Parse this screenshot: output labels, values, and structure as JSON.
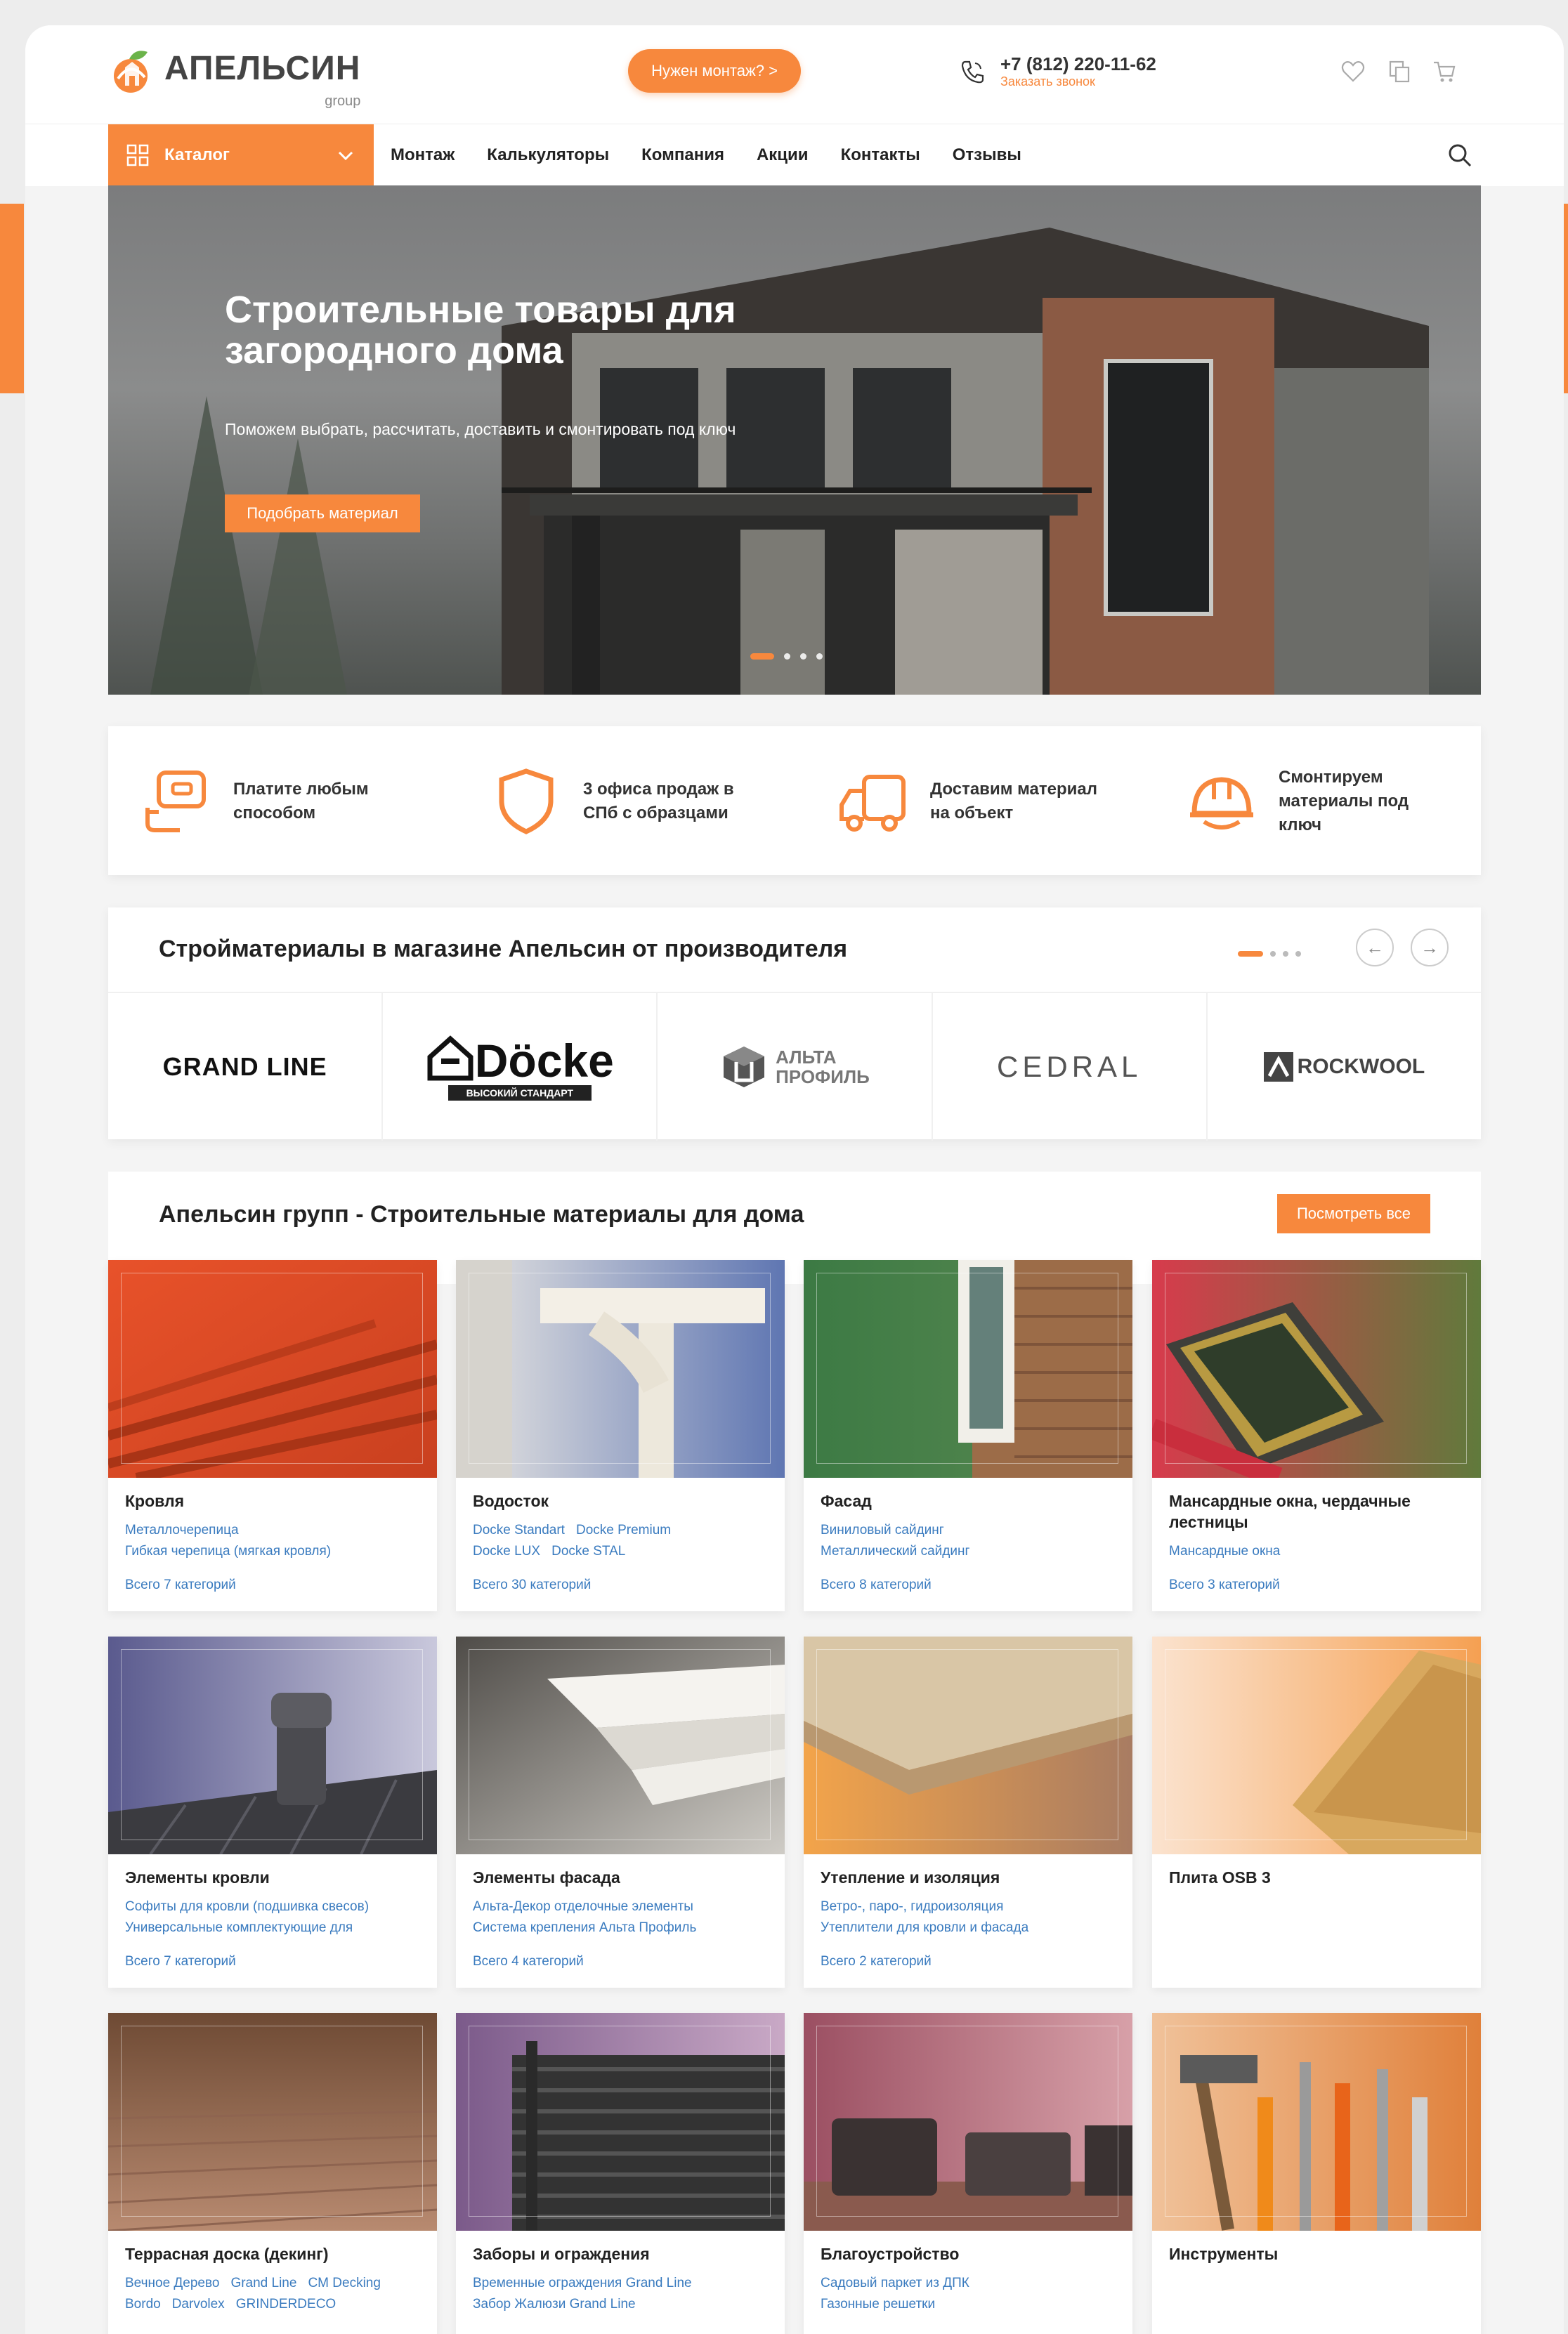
{
  "header": {
    "logo_text": "АПЕЛЬСИН",
    "logo_sub": "group",
    "montage_label": "Нужен монтаж? >",
    "phone": "+7 (812) 220-11-62",
    "callback": "Заказать звонок"
  },
  "nav": {
    "catalog_label": "Каталог",
    "links": [
      "Монтаж",
      "Калькуляторы",
      "Компания",
      "Акции",
      "Контакты",
      "Отзывы"
    ]
  },
  "hero": {
    "title": "Строительные товары для загородного дома",
    "subtitle": "Поможем выбрать, рассчитать, доставить и смонтировать под ключ",
    "button": "Подобрать материал"
  },
  "features": [
    {
      "icon": "wallet-icon",
      "text": "Платите любым способом"
    },
    {
      "icon": "shield-icon",
      "text": "3 офиса продаж в СПб с образцами"
    },
    {
      "icon": "truck-icon",
      "text": "Доставим материал на объект"
    },
    {
      "icon": "helmet-icon",
      "text": "Смонтируем материалы под ключ"
    }
  ],
  "brands": {
    "title": "Стройматериалы в магазине Апельсин от производителя",
    "items": {
      "grandline": "GRAND LINE",
      "docke": "Döcke",
      "docke_tag": "ВЫСОКИЙ СТАНДАРТ",
      "alta1": "АЛЬТА",
      "alta2": "ПРОФИЛЬ",
      "cedral": "CEDRAL",
      "rockwool": "ROCKWOOL"
    }
  },
  "categories": {
    "title": "Апельсин групп - Строительные материалы для дома",
    "view_all": "Посмотреть все",
    "items": [
      {
        "title": "Кровля",
        "sub1": [
          "Металлочерепица"
        ],
        "sub2": [
          "Гибкая черепица (мягкая кровля)"
        ],
        "total": "Всего 7 категорий"
      },
      {
        "title": "Водосток",
        "sub1": [
          "Docke Standart",
          "Docke Premium"
        ],
        "sub2": [
          "Docke LUX",
          "Docke STAL"
        ],
        "total": "Всего 30 категорий"
      },
      {
        "title": "Фасад",
        "sub1": [
          "Виниловый сайдинг"
        ],
        "sub2": [
          "Металлический сайдинг"
        ],
        "total": "Всего 8 категорий"
      },
      {
        "title": "Мансардные окна, чердачные лестницы",
        "sub1": [
          "Мансардные окна"
        ],
        "sub2": [],
        "total": "Всего 3 категорий"
      },
      {
        "title": "Элементы кровли",
        "sub1": [
          "Софиты для кровли (подшивка свесов)"
        ],
        "sub2": [
          "Универсальные комплектующие для"
        ],
        "total": "Всего 7 категорий"
      },
      {
        "title": "Элементы фасада",
        "sub1": [
          "Альта-Декор отделочные элементы"
        ],
        "sub2": [
          "Система крепления Альта Профиль"
        ],
        "total": "Всего 4 категорий"
      },
      {
        "title": "Утепление и изоляция",
        "sub1": [
          "Ветро-, паро-, гидроизоляция"
        ],
        "sub2": [
          "Утеплители для кровли и фасада"
        ],
        "total": "Всего 2 категорий"
      },
      {
        "title": "Плита OSB 3",
        "sub1": [],
        "sub2": [],
        "total": ""
      },
      {
        "title": "Террасная доска (декинг)",
        "sub1": [
          "Вечное Дерево",
          "Grand Line",
          "CM Decking"
        ],
        "sub2": [
          "Bordo",
          "Darvolex",
          "GRINDERDECO"
        ],
        "total": ""
      },
      {
        "title": "Заборы и ограждения",
        "sub1": [
          "Временные ограждения Grand Line"
        ],
        "sub2": [
          "Забор Жалюзи Grand Line"
        ],
        "total": ""
      },
      {
        "title": "Благоустройство",
        "sub1": [
          "Садовый паркет из ДПК"
        ],
        "sub2": [
          "Газонные решетки"
        ],
        "total": ""
      },
      {
        "title": "Инструменты",
        "sub1": [],
        "sub2": [],
        "total": ""
      }
    ]
  },
  "colors": {
    "accent": "#f7883d",
    "link": "#3a7bbf",
    "background": "#f4f4f4"
  }
}
